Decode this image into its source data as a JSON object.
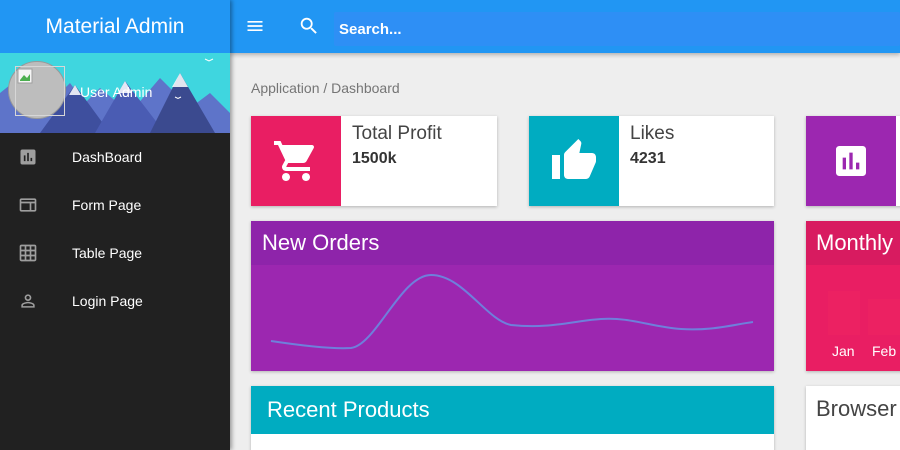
{
  "app": {
    "title": "Material Admin"
  },
  "user": {
    "name": "User Admin"
  },
  "sidebar": {
    "items": [
      {
        "label": "DashBoard",
        "icon": "assessment-icon"
      },
      {
        "label": "Form Page",
        "icon": "web-window-icon"
      },
      {
        "label": "Table Page",
        "icon": "grid-on-icon"
      },
      {
        "label": "Login Page",
        "icon": "person-outline-icon"
      }
    ]
  },
  "topbar": {
    "search_placeholder": "Search..."
  },
  "breadcrumb": "Application / Dashboard",
  "stats": [
    {
      "title": "Total Profit",
      "value": "1500k",
      "icon": "shopping-cart-icon",
      "color": "#e91e63"
    },
    {
      "title": "Likes",
      "value": "4231",
      "icon": "thumb-up-icon",
      "color": "#00acc1"
    },
    {
      "title": "",
      "value": "",
      "icon": "chart-icon",
      "color": "#9c27b0"
    }
  ],
  "new_orders": {
    "title": "New Orders",
    "color": "#9c27b0"
  },
  "monthly": {
    "title": "Monthly Sales",
    "months": [
      "Jan",
      "Feb"
    ],
    "color": "#e91e63"
  },
  "recent_products": {
    "title": "Recent Products",
    "color": "#00acc1"
  },
  "browser_usage": {
    "title": "Browser Usage"
  },
  "colors": {
    "primary": "#2196f3",
    "sidebar": "#212121"
  }
}
